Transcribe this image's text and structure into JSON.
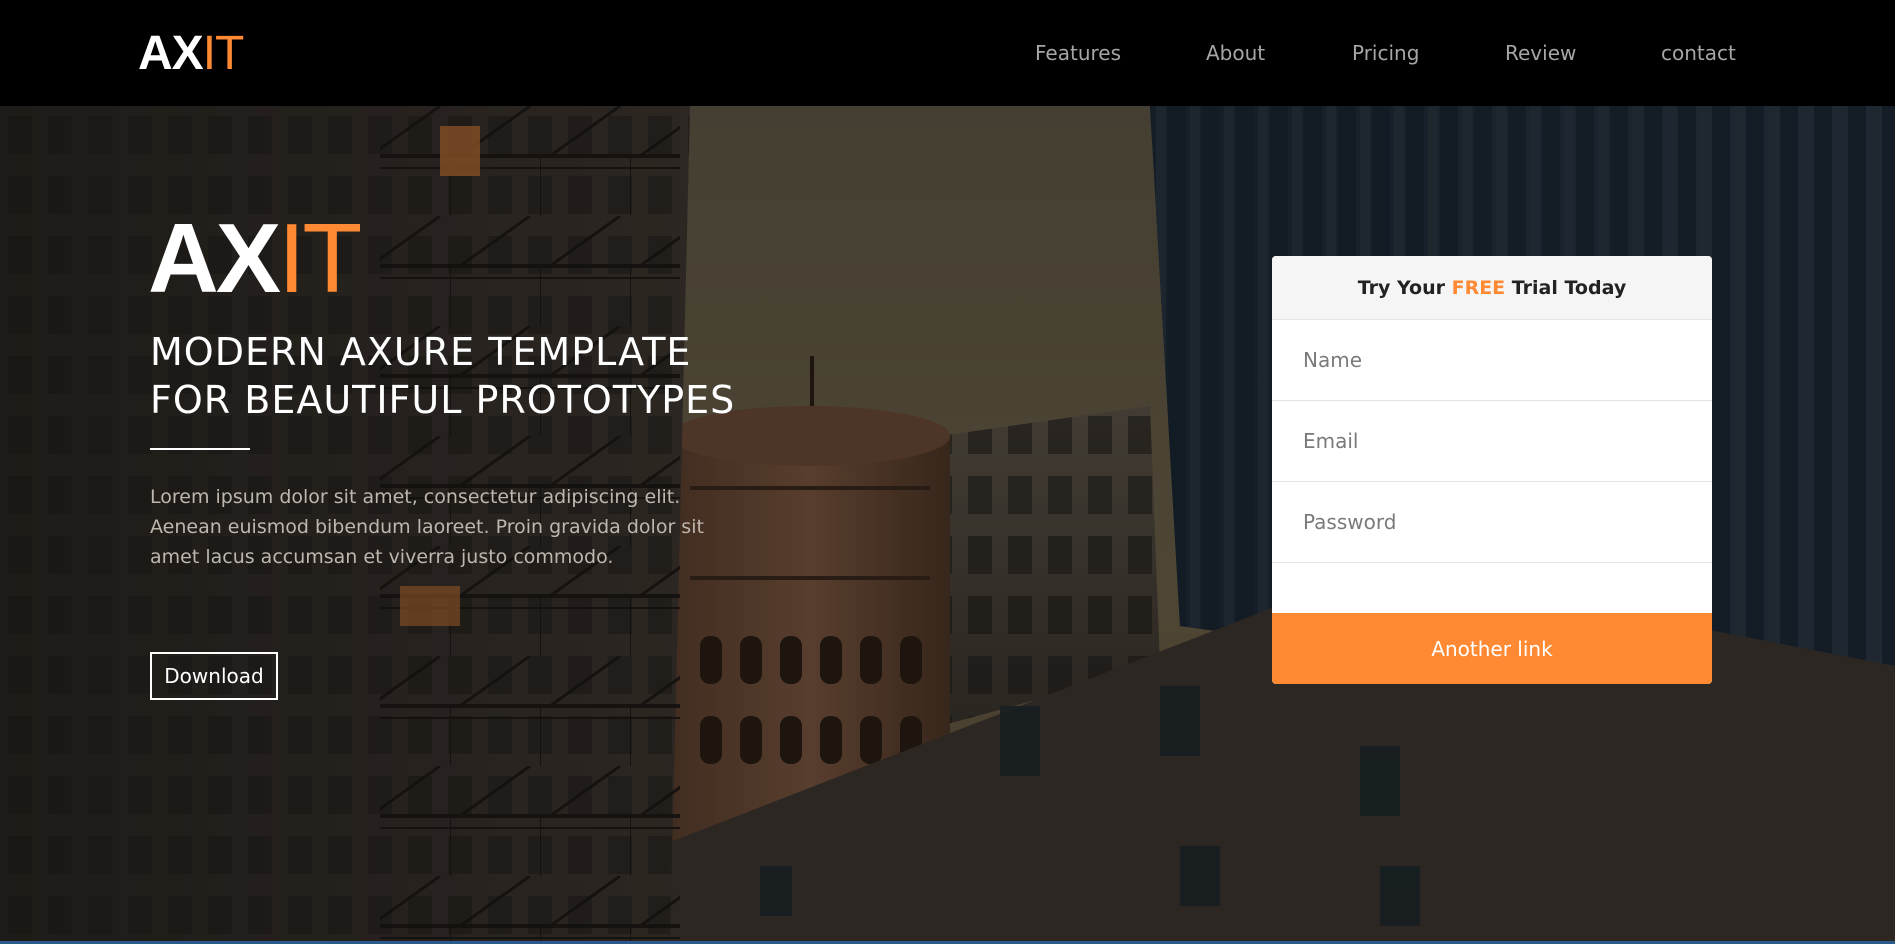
{
  "brand": {
    "main": "AX",
    "accent": "IT"
  },
  "nav": {
    "items": [
      {
        "label": "Features"
      },
      {
        "label": "About"
      },
      {
        "label": "Pricing"
      },
      {
        "label": "Review"
      },
      {
        "label": "contact"
      }
    ]
  },
  "hero": {
    "brand_main": "AX",
    "brand_accent": "IT",
    "headline_line1": "MODERN AXURE TEMPLATE",
    "headline_line2": "FOR BEAUTIFUL PROTOTYPES",
    "lead": "Lorem ipsum dolor sit amet, consectetur adipiscing elit. Aenean euismod bibendum laoreet. Proin gravida dolor sit amet lacus accumsan et viverra justo commodo.",
    "download_label": "Download"
  },
  "signup": {
    "title_before": "Try Your ",
    "title_highlight": "FREE",
    "title_after": " Trial Today",
    "name_placeholder": "Name",
    "email_placeholder": "Email",
    "password_placeholder": "Password",
    "submit_label": "Another link"
  },
  "colors": {
    "accent": "#ff8a33",
    "navbar_bg": "#000000",
    "nav_text": "#a6a6a6"
  }
}
